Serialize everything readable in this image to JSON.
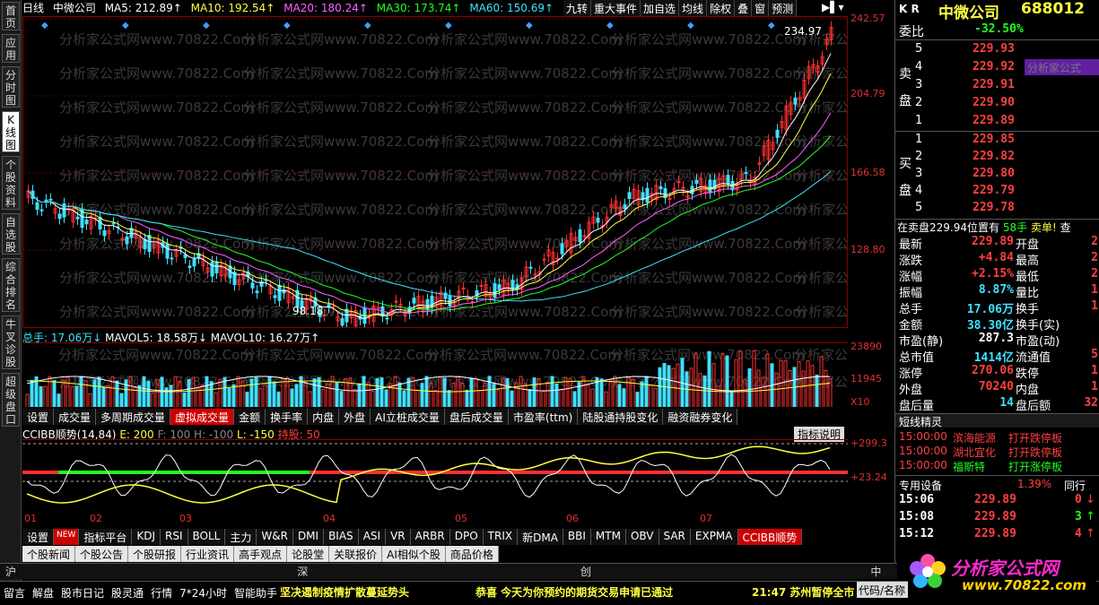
{
  "left_tabs": [
    "首页",
    "应用",
    "分时图",
    "K线图",
    "个股资料",
    "自选股",
    "综合排名",
    "牛叉诊股",
    "超级盘口"
  ],
  "topbar": {
    "period": "日线",
    "stock": "中微公司",
    "ma5": "MA5: 212.89↑",
    "ma10": "MA10: 192.54↑",
    "ma20": "MA20: 180.24↑",
    "ma30": "MA30: 173.74↑",
    "ma60": "MA60: 150.69↑"
  },
  "toolbuttons": [
    "九转",
    "重大事件",
    "加自选",
    "均线",
    "除权",
    "叠",
    "窗",
    "预测"
  ],
  "y_labels": [
    "242.57",
    "204.79",
    "166.58",
    "128.80"
  ],
  "price_high_label": "234.97",
  "price_low_label": "98.18",
  "vol_header": {
    "total": "总手: 17.06万↓",
    "mavol5": "MAVOL5: 18.58万↓",
    "mavol10": "MAVOL10: 16.27万↑"
  },
  "vol_y_labels": [
    "23890",
    "11945",
    "X10"
  ],
  "tabrow1": [
    "设置",
    "成交量",
    "多周期成交量",
    "虚拟成交量",
    "金额",
    "换手率",
    "内盘",
    "外盘",
    "AI立桩成交量",
    "盘后成交量",
    "市盈率(ttm)",
    "陆股通持股变化",
    "融资融券变化"
  ],
  "cci_header": {
    "name": "CCIBB顺势(14,84)",
    "e": "E: 200",
    "f": "F: 100",
    "h": "H: -100",
    "l": "L: -150",
    "hold": "持股: 50"
  },
  "cci_button": "指标说明",
  "cci_y_labels": [
    "+299.3",
    "+23.24"
  ],
  "x_labels": [
    "01",
    "02",
    "03",
    "04",
    "05",
    "06",
    "07"
  ],
  "tabrow2": [
    "设置",
    "NEW",
    "指标平台",
    "KDJ",
    "RSI",
    "BOLL",
    "主力",
    "W&R",
    "DMI",
    "BIAS",
    "ASI",
    "VR",
    "ARBR",
    "DPO",
    "TRIX",
    "新DMA",
    "BBI",
    "MTM",
    "OBV",
    "SAR",
    "EXPMA",
    "CCIBB顺势"
  ],
  "tabrow3": [
    "个股新闻",
    "个股公告",
    "个股研报",
    "行业资讯",
    "高手观点",
    "论股堂",
    "关联报价",
    "AI相似个股",
    "商品价格"
  ],
  "bottombar": [
    "沪",
    "深",
    "创",
    "中小"
  ],
  "statusbar": {
    "items": [
      "留言",
      "解盘",
      "股市日记",
      "股灵通",
      "行情",
      "7*24小时",
      "智能助手"
    ],
    "scroll1": "坚决遏制疫情扩散蔓延势头",
    "scroll2": "恭喜 今天为你预约的期货交易申请已通过",
    "time": "21:47 苏州暂停全市",
    "code_btn": "代码/名称"
  },
  "watermark": "分析家公式网www.70822.Com",
  "logo": {
    "name": "分析家公式网",
    "url": "www.70822.com"
  },
  "right": {
    "kr": "K R",
    "name": "中微公司",
    "code": "688012",
    "weibi_label": "委比",
    "weibi": "-32.50%",
    "sell_label": "卖盘",
    "buy_label": "买盘",
    "sell": [
      {
        "n": "5",
        "p": "229.93"
      },
      {
        "n": "4",
        "p": "229.92"
      },
      {
        "n": "3",
        "p": "229.91"
      },
      {
        "n": "2",
        "p": "229.90"
      },
      {
        "n": "1",
        "p": "229.89"
      }
    ],
    "buy": [
      {
        "n": "1",
        "p": "229.85"
      },
      {
        "n": "2",
        "p": "229.82"
      },
      {
        "n": "3",
        "p": "229.80"
      },
      {
        "n": "4",
        "p": "229.79"
      },
      {
        "n": "5",
        "p": "229.78"
      }
    ],
    "sell_highlight": "分析家公式",
    "info_line": "在卖盘229.94位置有",
    "info_hands": "58手",
    "info_sell": "卖单!",
    "info_extra": "查",
    "stats": [
      {
        "l": "最新",
        "v": "229.89",
        "l2": "开盘",
        "c": "red"
      },
      {
        "l": "涨跌",
        "v": "+4.84",
        "l2": "最高",
        "c": "red"
      },
      {
        "l": "涨幅",
        "v": "+2.15%",
        "l2": "最低",
        "c": "red"
      },
      {
        "l": "振幅",
        "v": "8.87%",
        "l2": "量比",
        "c": "cyn"
      },
      {
        "l": "总手",
        "v": "17.06万",
        "l2": "换手",
        "c": "cyn"
      },
      {
        "l": "金额",
        "v": "38.30亿",
        "l2": "换手(实)",
        "c": "cyn"
      },
      {
        "l": "市盈(静)",
        "v": "287.3",
        "l2": "市盈(动)",
        "c": "wht"
      },
      {
        "l": "总市值",
        "v": "1414亿",
        "l2": "流通值",
        "c": "cyn"
      },
      {
        "l": "涨停",
        "v": "270.06",
        "l2": "跌停",
        "c": "red"
      },
      {
        "l": "外盘",
        "v": "70240",
        "l2": "内盘",
        "c": "red"
      },
      {
        "l": "盘后量",
        "v": "14",
        "l2": "盘后额",
        "c": "cyn"
      }
    ],
    "stats_right": [
      "2",
      "2",
      "2",
      "1",
      "1",
      "",
      "",
      "5",
      "1",
      "1",
      "32"
    ],
    "short_title": "短线精灵",
    "short": [
      {
        "t": "15:00:00",
        "n": "滨海能源",
        "a": "打开跌停板",
        "c": "red"
      },
      {
        "t": "15:00:00",
        "n": "湖北宜化",
        "a": "打开跌停板",
        "c": "red"
      },
      {
        "t": "15:00:00",
        "n": "福斯特",
        "a": "打开涨停板",
        "c": "grn"
      }
    ],
    "sector": "专用设备",
    "sector_pct": "1.39%",
    "sector_btn": "同行",
    "ticks": [
      {
        "t": "15:06",
        "p": "229.89",
        "v": "0",
        "a": "↓",
        "c": "red"
      },
      {
        "t": "15:08",
        "p": "229.89",
        "v": "3",
        "a": "↑",
        "c": "grn"
      },
      {
        "t": "15:12",
        "p": "229.89",
        "v": "4",
        "a": "↑",
        "c": "red"
      }
    ]
  }
}
